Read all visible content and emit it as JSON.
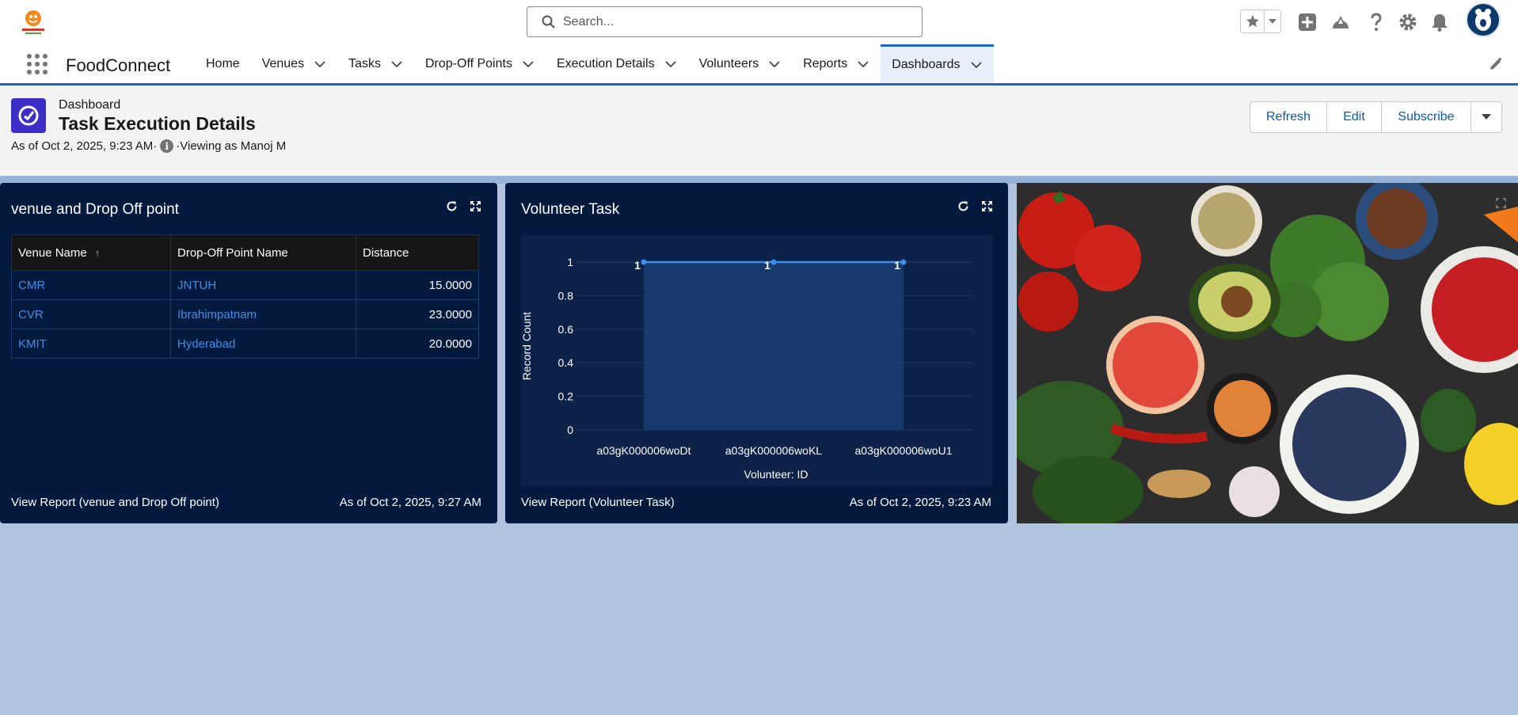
{
  "app": {
    "name": "FoodConnect",
    "search_placeholder": "Search..."
  },
  "nav": {
    "items": [
      {
        "label": "Home",
        "has_menu": false
      },
      {
        "label": "Venues",
        "has_menu": true
      },
      {
        "label": "Tasks",
        "has_menu": true
      },
      {
        "label": "Drop-Off Points",
        "has_menu": true
      },
      {
        "label": "Execution Details",
        "has_menu": true
      },
      {
        "label": "Volunteers",
        "has_menu": true
      },
      {
        "label": "Reports",
        "has_menu": true
      },
      {
        "label": "Dashboards",
        "has_menu": true,
        "active": true
      }
    ]
  },
  "header": {
    "object_type": "Dashboard",
    "title": "Task Execution Details",
    "as_of": "As of Oct 2, 2025, 9:23 AM·",
    "info_glyph": "i",
    "viewing_as": "·Viewing as Manoj M",
    "buttons": {
      "refresh": "Refresh",
      "edit": "Edit",
      "subscribe": "Subscribe"
    }
  },
  "table_panel": {
    "title": "venue and Drop Off point",
    "columns": [
      "Venue Name",
      "Drop-Off Point Name",
      "Distance"
    ],
    "sort_indicator": "↑",
    "rows": [
      {
        "venue": "CMR",
        "dropoff": "JNTUH",
        "distance": "15.0000"
      },
      {
        "venue": "CVR",
        "dropoff": "Ibrahimpatnam",
        "distance": "23.0000"
      },
      {
        "venue": "KMIT",
        "dropoff": "Hyderabad",
        "distance": "20.0000"
      }
    ],
    "footer_link": "View Report (venue and Drop Off point)",
    "footer_time": "As of Oct 2, 2025, 9:27 AM"
  },
  "chart_panel": {
    "title": "Volunteer Task",
    "footer_link": "View Report (Volunteer Task)",
    "footer_time": "As of Oct 2, 2025, 9:23 AM"
  },
  "chart_data": {
    "type": "area",
    "title": "Volunteer Task",
    "categories": [
      "a03gK000006woDt",
      "a03gK000006woKL",
      "a03gK000006woU1"
    ],
    "values": [
      1,
      1,
      1
    ],
    "data_labels": [
      "1",
      "1",
      "1"
    ],
    "xlabel": "Volunteer: ID",
    "ylabel": "Record Count",
    "yticks": [
      "0",
      "0.2",
      "0.4",
      "0.6",
      "0.8",
      "1"
    ],
    "ylim": [
      0,
      1
    ],
    "grid": true,
    "colors": {
      "line": "#3a8fe8",
      "fill": "#1b3d72"
    }
  },
  "colors": {
    "brand_blue": "#1b68c4",
    "panel_bg": "#011a3e",
    "canvas_bg": "#b0c4df",
    "link_blue": "#0b5cab"
  }
}
